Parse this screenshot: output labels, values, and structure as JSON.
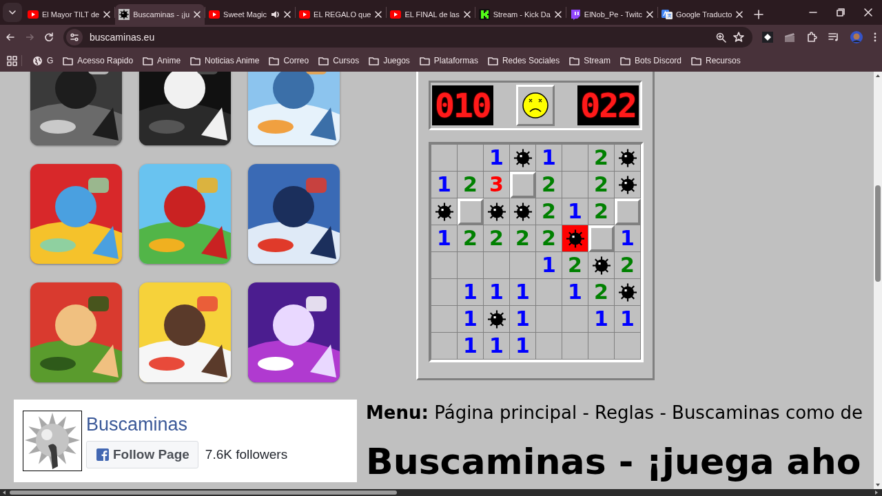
{
  "tabs": [
    {
      "title": "El Mayor TILT de",
      "kind": "video",
      "selected": false,
      "audio": false
    },
    {
      "title": "Buscaminas - ¡ju",
      "kind": "mine",
      "selected": true,
      "audio": false
    },
    {
      "title": "Sweet Magic",
      "kind": "video",
      "selected": false,
      "audio": true
    },
    {
      "title": "EL REGALO que",
      "kind": "video",
      "selected": false,
      "audio": false
    },
    {
      "title": "EL FINAL de las",
      "kind": "video",
      "selected": false,
      "audio": false
    },
    {
      "title": "Stream - Kick Da",
      "kind": "kick",
      "selected": false,
      "audio": false
    },
    {
      "title": "ElNob_Pe - Twitc",
      "kind": "twitch",
      "selected": false,
      "audio": false
    },
    {
      "title": "Google Traducto",
      "kind": "translate",
      "selected": false,
      "audio": false
    }
  ],
  "address_bar": {
    "url": "buscaminas.eu"
  },
  "bookmarks": [
    {
      "label": "G",
      "kind": "site"
    },
    {
      "label": "Acesso Rapido",
      "kind": "folder"
    },
    {
      "label": "Anime",
      "kind": "folder"
    },
    {
      "label": "Noticias Anime",
      "kind": "folder"
    },
    {
      "label": "Correo",
      "kind": "folder"
    },
    {
      "label": "Cursos",
      "kind": "folder"
    },
    {
      "label": "Juegos",
      "kind": "folder"
    },
    {
      "label": "Plataformas",
      "kind": "folder"
    },
    {
      "label": "Redes Sociales",
      "kind": "folder"
    },
    {
      "label": "Stream",
      "kind": "folder"
    },
    {
      "label": "Bots Discord",
      "kind": "folder"
    },
    {
      "label": "Recursos",
      "kind": "folder"
    }
  ],
  "minesweeper": {
    "mines_counter": "010",
    "timer": "022",
    "face": {
      "kind": "dead"
    },
    "rows": [
      [
        {
          "kind": "empty"
        },
        {
          "kind": "empty"
        },
        {
          "kind": "number",
          "text": "1",
          "color": "#0000ff"
        },
        {
          "kind": "mine"
        },
        {
          "kind": "number",
          "text": "1",
          "color": "#0000ff"
        },
        {
          "kind": "empty"
        },
        {
          "kind": "number",
          "text": "2",
          "color": "#008000"
        },
        {
          "kind": "mine"
        }
      ],
      [
        {
          "kind": "number",
          "text": "1",
          "color": "#0000ff"
        },
        {
          "kind": "number",
          "text": "2",
          "color": "#008000"
        },
        {
          "kind": "number",
          "text": "3",
          "color": "#ff0000"
        },
        {
          "kind": "covered"
        },
        {
          "kind": "number",
          "text": "2",
          "color": "#008000"
        },
        {
          "kind": "empty"
        },
        {
          "kind": "number",
          "text": "2",
          "color": "#008000"
        },
        {
          "kind": "mine"
        }
      ],
      [
        {
          "kind": "mine"
        },
        {
          "kind": "covered"
        },
        {
          "kind": "mine"
        },
        {
          "kind": "mine"
        },
        {
          "kind": "number",
          "text": "2",
          "color": "#008000"
        },
        {
          "kind": "number",
          "text": "1",
          "color": "#0000ff"
        },
        {
          "kind": "number",
          "text": "2",
          "color": "#008000"
        },
        {
          "kind": "covered"
        }
      ],
      [
        {
          "kind": "number",
          "text": "1",
          "color": "#0000ff"
        },
        {
          "kind": "number",
          "text": "2",
          "color": "#008000"
        },
        {
          "kind": "number",
          "text": "2",
          "color": "#008000"
        },
        {
          "kind": "number",
          "text": "2",
          "color": "#008000"
        },
        {
          "kind": "number",
          "text": "2",
          "color": "#008000"
        },
        {
          "kind": "exploded"
        },
        {
          "kind": "covered"
        },
        {
          "kind": "number",
          "text": "1",
          "color": "#0000ff"
        }
      ],
      [
        {
          "kind": "empty"
        },
        {
          "kind": "empty"
        },
        {
          "kind": "empty"
        },
        {
          "kind": "empty"
        },
        {
          "kind": "number",
          "text": "1",
          "color": "#0000ff"
        },
        {
          "kind": "number",
          "text": "2",
          "color": "#008000"
        },
        {
          "kind": "mine"
        },
        {
          "kind": "number",
          "text": "2",
          "color": "#008000"
        }
      ],
      [
        {
          "kind": "empty"
        },
        {
          "kind": "number",
          "text": "1",
          "color": "#0000ff"
        },
        {
          "kind": "number",
          "text": "1",
          "color": "#0000ff"
        },
        {
          "kind": "number",
          "text": "1",
          "color": "#0000ff"
        },
        {
          "kind": "empty"
        },
        {
          "kind": "number",
          "text": "1",
          "color": "#0000ff"
        },
        {
          "kind": "number",
          "text": "2",
          "color": "#008000"
        },
        {
          "kind": "mine"
        }
      ],
      [
        {
          "kind": "empty"
        },
        {
          "kind": "number",
          "text": "1",
          "color": "#0000ff"
        },
        {
          "kind": "mine"
        },
        {
          "kind": "number",
          "text": "1",
          "color": "#0000ff"
        },
        {
          "kind": "empty"
        },
        {
          "kind": "empty"
        },
        {
          "kind": "number",
          "text": "1",
          "color": "#0000ff"
        },
        {
          "kind": "number",
          "text": "1",
          "color": "#0000ff"
        }
      ],
      [
        {
          "kind": "empty"
        },
        {
          "kind": "number",
          "text": "1",
          "color": "#0000ff"
        },
        {
          "kind": "number",
          "text": "1",
          "color": "#0000ff"
        },
        {
          "kind": "number",
          "text": "1",
          "color": "#0000ff"
        },
        {
          "kind": "empty"
        },
        {
          "kind": "empty"
        },
        {
          "kind": "empty"
        },
        {
          "kind": "empty"
        }
      ]
    ]
  },
  "facebook_card": {
    "page_name": "Buscaminas",
    "follow_button": "Follow Page",
    "followers": "7.6K followers"
  },
  "menu_line": "**Menu:** Página principal - Reglas - Buscaminas como de",
  "heading": "Buscaminas - ¡juega aho"
}
